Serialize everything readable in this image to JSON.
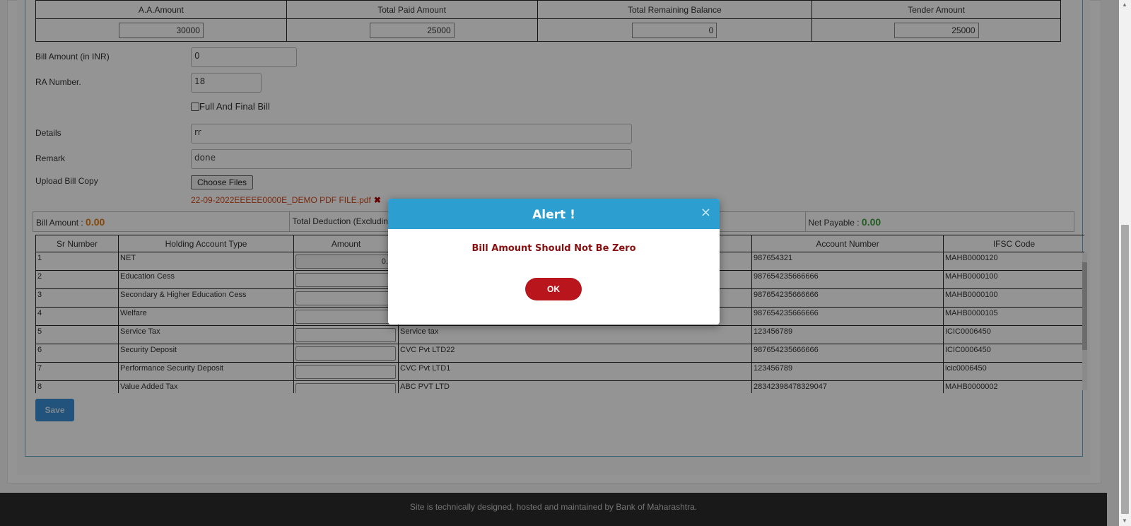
{
  "summary_table": {
    "headers": [
      "A.A.Amount",
      "Total Paid Amount",
      "Total Remaining Balance",
      "Tender Amount"
    ],
    "values": [
      "30000",
      "25000",
      "0",
      "25000"
    ]
  },
  "form": {
    "bill_amount_label": "Bill Amount (in INR)",
    "bill_amount_value": "0",
    "ra_number_label": "RA Number.",
    "ra_number_value": "18",
    "full_final_label": "Full And Final Bill",
    "details_label": "Details",
    "details_value": "rr",
    "remark_label": "Remark",
    "remark_value": "done",
    "upload_label": "Upload Bill Copy",
    "choose_files_label": "Choose Files",
    "uploaded_file": "22-09-2022EEEEE0000E_DEMO PDF FILE.pdf",
    "remove_icon": "✖"
  },
  "summary_bar": {
    "bill_amount_label": "Bill Amount :",
    "bill_amount_value": "0.00",
    "total_deduction_label": "Total Deduction (Excluding",
    "net_payable_label": "Net Payable :",
    "net_payable_value": "0.00"
  },
  "deductions": {
    "headers": [
      "Sr Number",
      "Holding Account Type",
      "Amount",
      "",
      "Account Number",
      "IFSC Code"
    ],
    "rows": [
      {
        "sr": "1",
        "type": "NET",
        "amount": "0.0",
        "name": "",
        "account": "987654321",
        "ifsc": "MAHB0000120"
      },
      {
        "sr": "2",
        "type": "Education Cess",
        "amount": "",
        "name": "",
        "account": "987654235666666",
        "ifsc": "MAHB0000100"
      },
      {
        "sr": "3",
        "type": "Secondary & Higher Education Cess",
        "amount": "",
        "name": "",
        "account": "987654235666666",
        "ifsc": "MAHB0000100"
      },
      {
        "sr": "4",
        "type": "Welfare",
        "amount": "",
        "name": "",
        "account": "987654235666666",
        "ifsc": "MAHB0000105"
      },
      {
        "sr": "5",
        "type": "Service Tax",
        "amount": "",
        "name": "Service tax",
        "account": "123456789",
        "ifsc": "ICIC0006450"
      },
      {
        "sr": "6",
        "type": "Security Deposit",
        "amount": "",
        "name": "CVC Pvt LTD22",
        "account": "987654235666666",
        "ifsc": "ICIC0006450"
      },
      {
        "sr": "7",
        "type": "Performance Security Deposit",
        "amount": "",
        "name": "CVC Pvt LTD1",
        "account": "123456789",
        "ifsc": "icic0006450"
      },
      {
        "sr": "8",
        "type": "Value Added Tax",
        "amount": "",
        "name": "ABC PVT LTD",
        "account": "28342398478329047",
        "ifsc": "MAHB0000002"
      }
    ]
  },
  "save_label": "Save",
  "footer_text": "Site is technically designed, hosted and maintained by Bank of Maharashtra.",
  "modal": {
    "title": "Alert !",
    "close_glyph": "×",
    "message": "Bill Amount Should Not Be Zero",
    "ok_label": "OK"
  },
  "colors": {
    "modal_header": "#2c9fd0",
    "ok_button": "#b8161c",
    "message": "#8a1010",
    "bill_amount": "#e07a10",
    "net_payable": "#3aa33a"
  }
}
